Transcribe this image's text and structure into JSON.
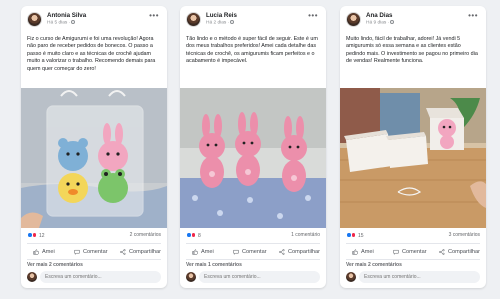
{
  "posts": [
    {
      "author": "Antonia Silva",
      "time": "Há 5 dias ·",
      "text": "Fiz o curso de Amigurumi e foi uma revolução! Agora não paro de receber pedidos de bonecos. O passo a passo é muito claro e as técnicas de crochê ajudam muito a valorizar o trabalho. Recomendo demais para quem quer começar do zero!",
      "photo": "crochet-bears-in-gift-bag",
      "reactions": "12",
      "comments": "2 comentários"
    },
    {
      "author": "Lucia Reis",
      "time": "Há 2 dias ·",
      "text": "Tão lindo e o método é super fácil de seguir. Este é um dos meus trabalhos preferidos! Amei cada detalhe das técnicas de crochê, os amigurumis ficam perfeitos e o acabamento é impecável.",
      "photo": "pink-crochet-bunnies",
      "reactions": "8",
      "comments": "1 comentário"
    },
    {
      "author": "Ana Dias",
      "time": "Há 9 dias ·",
      "text": "Muito lindo, fácil de trabalhar, adorei! Já vendi 5 amigurumis só essa semana e as clientes estão pedindo mais. O investimento se pagou no primeiro dia de vendas! Realmente funciona.",
      "photo": "boxed-crochet-toy-on-table",
      "reactions": "15",
      "comments": "3 comentários"
    }
  ],
  "actions": {
    "like": "Amei",
    "comment": "Comentar",
    "share": "Compartilhar"
  },
  "more_comments": "Ver mais 2 comentários",
  "more_comments_alt": "Ver mais 1 comentários",
  "comment_placeholder": "Escreva um comentário...",
  "colors": {
    "accent": "#1877f2",
    "love": "#f0284a",
    "background": "#eef0f3"
  }
}
